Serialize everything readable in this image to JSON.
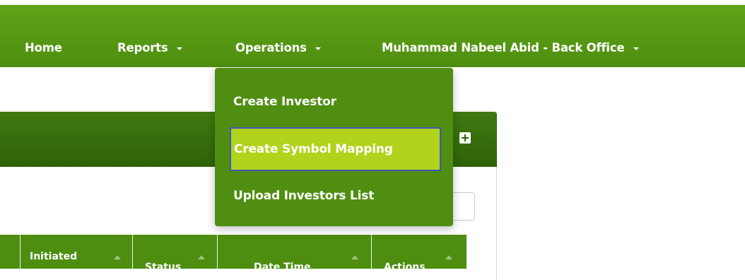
{
  "navbar": {
    "home": "Home",
    "reports": "Reports",
    "operations": "Operations",
    "user": "Muhammad Nabeel Abid - Back Office"
  },
  "dropdown": {
    "items": [
      "Create Investor",
      "Create Symbol Mapping",
      "Upload Investors List"
    ]
  },
  "table": {
    "headers": [
      "Initiated",
      "Status",
      "Date Time",
      "Actions"
    ]
  },
  "icons": {
    "add": "plus-icon",
    "dropdown_caret": "caret-down-icon",
    "sort": "sort-icon"
  },
  "colors": {
    "navbar": "#5fa317",
    "panel_header": "#2f6208",
    "dropdown": "#4f8e11",
    "highlight": "#b1d31b",
    "focus_border": "#3f58b9"
  }
}
